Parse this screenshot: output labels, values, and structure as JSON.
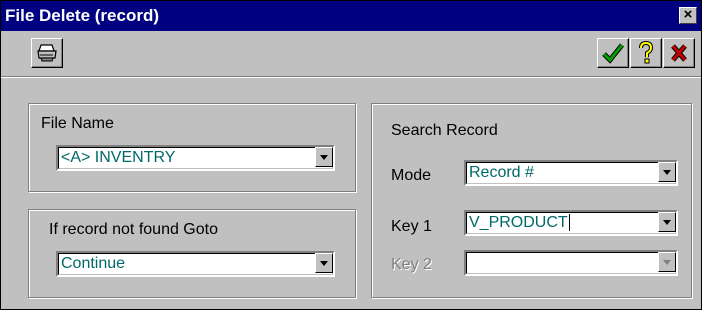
{
  "window": {
    "title": "File Delete (record)",
    "close_glyph": "×"
  },
  "toolbar": {
    "left_button_icon": "printer-icon",
    "ok_icon": "checkmark-icon",
    "help_icon": "question-mark-icon",
    "cancel_icon": "red-x-icon"
  },
  "file_name_group": {
    "label": "File Name",
    "value": "<A> INVENTRY"
  },
  "not_found_group": {
    "label": "If record not found Goto",
    "value": "Continue"
  },
  "search_group": {
    "label": "Search Record",
    "mode_label": "Mode",
    "mode_value": "Record #",
    "key1_label": "Key 1",
    "key1_value": "V_PRODUCT",
    "key2_label": "Key 2",
    "key2_value": ""
  },
  "colors": {
    "titlebar": "#000080",
    "face": "#c0c0c0",
    "field_text": "#006868",
    "ok_green": "#00a000",
    "help_yellow": "#ffff00",
    "cancel_red": "#c00000"
  }
}
